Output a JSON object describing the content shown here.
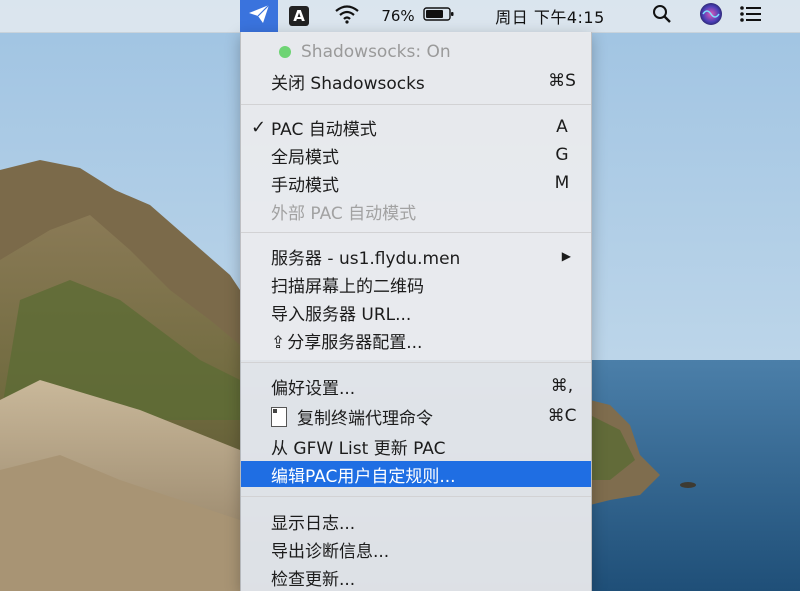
{
  "menubar": {
    "input_source": "A",
    "battery_percent": "76%",
    "clock": "周日 下午4:15",
    "icons": [
      "shadowsocks-icon",
      "input-source-icon",
      "wifi-icon",
      "battery-icon",
      "spotlight-search-icon",
      "siri-icon",
      "notification-center-icon"
    ]
  },
  "menu": {
    "status": "Shadowsocks: On",
    "toggle": {
      "label": "关闭 Shadowsocks",
      "shortcut": "⌘S"
    },
    "modes": [
      {
        "label": "PAC 自动模式",
        "shortcut": "A",
        "checked": true
      },
      {
        "label": "全局模式",
        "shortcut": "G"
      },
      {
        "label": "手动模式",
        "shortcut": "M"
      },
      {
        "label": "外部 PAC 自动模式",
        "disabled": true
      }
    ],
    "servers": [
      {
        "label": "服务器 - us1.flydu.men",
        "submenu": true
      },
      {
        "label": "扫描屏幕上的二维码"
      },
      {
        "label": "导入服务器 URL..."
      },
      {
        "label": "分享服务器配置..."
      }
    ],
    "settings": [
      {
        "label": "偏好设置...",
        "shortcut": "⌘,"
      },
      {
        "label": "复制终端代理命令",
        "shortcut": "⌘C"
      },
      {
        "label": "从 GFW List 更新 PAC"
      },
      {
        "label": "编辑PAC用户自定规则...",
        "highlighted": true
      }
    ],
    "tools": [
      {
        "label": "显示日志..."
      },
      {
        "label": "导出诊断信息..."
      },
      {
        "label": "检查更新..."
      }
    ]
  },
  "colors": {
    "highlight": "#1f6ee3",
    "status_green": "#6ed474",
    "menubar_active": "#3a73dd"
  }
}
